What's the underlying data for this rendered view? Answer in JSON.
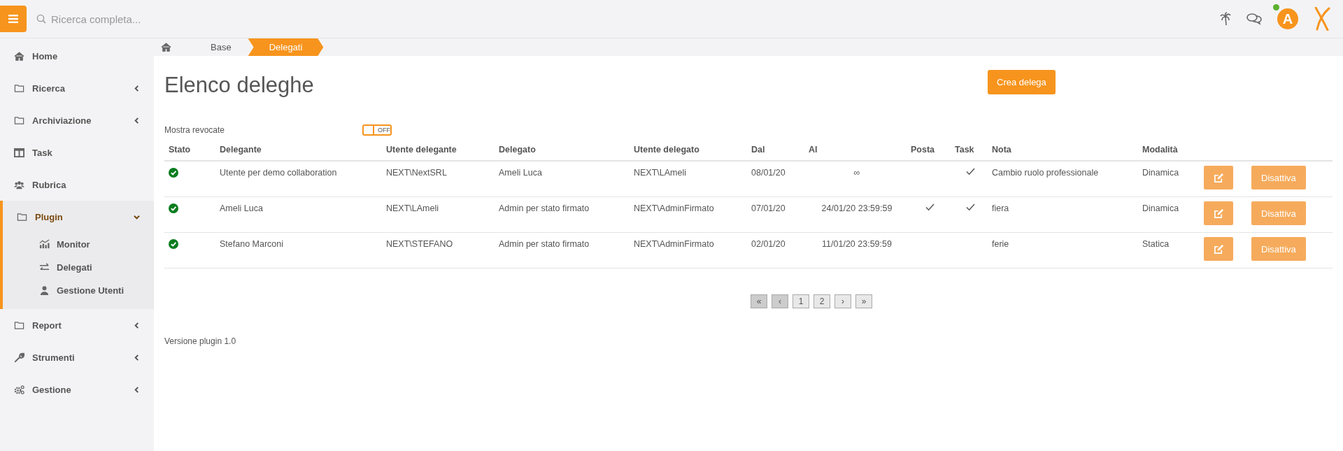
{
  "topbar": {
    "search": {
      "placeholder": "Ricerca completa..."
    },
    "avatar": {
      "letter": "A",
      "online": true
    }
  },
  "sidebar": {
    "items": [
      {
        "label": "Home",
        "expandable": false,
        "active": false
      },
      {
        "label": "Ricerca",
        "expandable": true,
        "expanded": false,
        "active": false
      },
      {
        "label": "Archiviazione",
        "expandable": true,
        "expanded": false,
        "active": false
      },
      {
        "label": "Task",
        "expandable": false,
        "active": false
      },
      {
        "label": "Rubrica",
        "expandable": false,
        "active": false
      },
      {
        "label": "Plugin",
        "expandable": true,
        "expanded": true,
        "active": true,
        "children": [
          {
            "label": "Monitor"
          },
          {
            "label": "Delegati"
          },
          {
            "label": "Gestione Utenti"
          }
        ]
      },
      {
        "label": "Report",
        "expandable": true,
        "expanded": false,
        "active": false
      },
      {
        "label": "Strumenti",
        "expandable": true,
        "expanded": false,
        "active": false
      },
      {
        "label": "Gestione",
        "expandable": true,
        "expanded": false,
        "active": false
      }
    ]
  },
  "breadcrumb": [
    {
      "label": "Base",
      "selected": false
    },
    {
      "label": "Delegati",
      "selected": true
    }
  ],
  "page": {
    "title": "Elenco deleghe",
    "create_button": "Crea delega",
    "toggle": {
      "label": "Mostra revocate",
      "on": false,
      "text": "OFF"
    },
    "table": {
      "columns": [
        "Stato",
        "Delegante",
        "Utente delegante",
        "Delegato",
        "Utente delegato",
        "Dal",
        "Al",
        "Posta",
        "Task",
        "Nota",
        "Modalità"
      ],
      "rows": [
        {
          "active": true,
          "delegante": "Utente per demo collaboration",
          "utente_delegante": "NEXT\\NextSRL",
          "delegato": "Ameli Luca",
          "utente_delegato": "NEXT\\LAmeli",
          "dal": "08/01/20",
          "al": "∞",
          "posta": false,
          "task": true,
          "nota": "Cambio ruolo professionale",
          "modalita": "Dinamica",
          "action": "Disattiva"
        },
        {
          "active": true,
          "delegante": "Ameli Luca",
          "utente_delegante": "NEXT\\LAmeli",
          "delegato": "Admin per stato firmato",
          "utente_delegato": "NEXT\\AdminFirmato",
          "dal": "07/01/20",
          "al": "24/01/20 23:59:59",
          "posta": true,
          "task": true,
          "nota": "fiera",
          "modalita": "Dinamica",
          "action": "Disattiva"
        },
        {
          "active": true,
          "delegante": "Stefano Marconi",
          "utente_delegante": "NEXT\\STEFANO",
          "delegato": "Admin per stato firmato",
          "utente_delegato": "NEXT\\AdminFirmato",
          "dal": "02/01/20",
          "al": "11/01/20 23:59:59",
          "posta": false,
          "task": false,
          "nota": "ferie",
          "modalita": "Statica",
          "action": "Disattiva"
        }
      ]
    },
    "pagination": [
      {
        "label": "«",
        "disabled": true
      },
      {
        "label": "‹",
        "disabled": true
      },
      {
        "label": "1",
        "disabled": false
      },
      {
        "label": "2",
        "disabled": false
      },
      {
        "label": "›",
        "disabled": false
      },
      {
        "label": "»",
        "disabled": false
      }
    ],
    "version": "Versione plugin 1.0"
  }
}
